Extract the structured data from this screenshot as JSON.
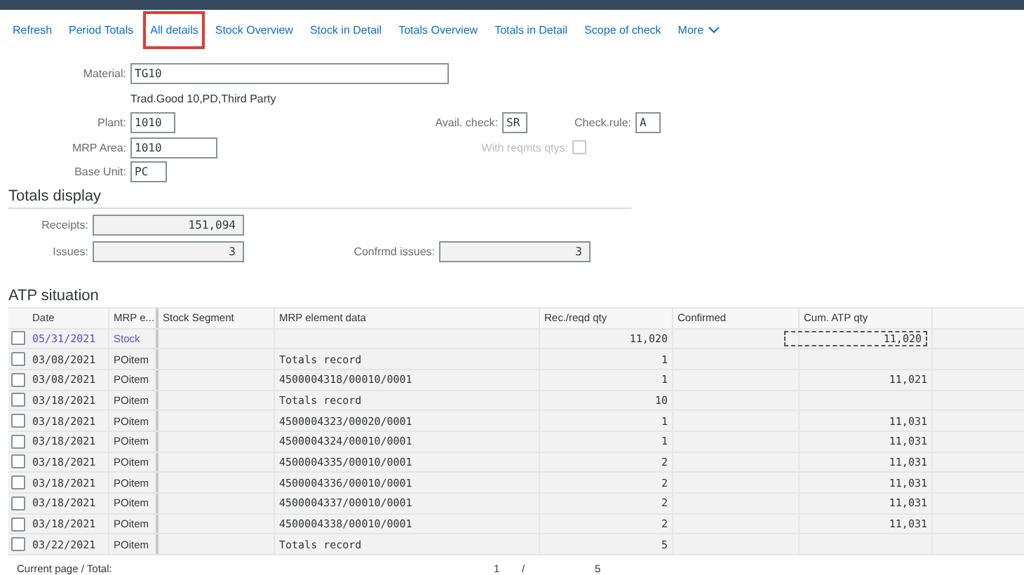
{
  "toolbar": [
    {
      "label": "Refresh",
      "highlighted": false
    },
    {
      "label": "Period Totals",
      "highlighted": false
    },
    {
      "label": "All details",
      "highlighted": true
    },
    {
      "label": "Stock Overview",
      "highlighted": false
    },
    {
      "label": "Stock in Detail",
      "highlighted": false
    },
    {
      "label": "Totals Overview",
      "highlighted": false
    },
    {
      "label": "Totals in Detail",
      "highlighted": false
    },
    {
      "label": "Scope of check",
      "highlighted": false
    }
  ],
  "more": {
    "label": "More"
  },
  "header": {
    "material_label": "Material:",
    "material": "TG10",
    "description": "Trad.Good 10,PD,Third Party",
    "plant_label": "Plant:",
    "plant": "1010",
    "avail_label": "Avail. check:",
    "avail": "SR",
    "rule_label": "Check.rule:",
    "rule": "A",
    "mrp_area_label": "MRP Area:",
    "mrp_area": "1010",
    "reqmts_label": "With reqmts qtys:",
    "reqmts_checked": false,
    "unit_label": "Base Unit:",
    "unit": "PC"
  },
  "totals": {
    "title": "Totals display",
    "receipts_label": "Receipts:",
    "receipts": "151,094",
    "issues_label": "Issues:",
    "issues": "3",
    "confirmed_label": "Confrmd issues:",
    "confirmed": "3"
  },
  "atp": {
    "title": "ATP situation",
    "columns": [
      "Date",
      "MRP e...",
      "Stock Segment",
      "MRP element data",
      "Rec./reqd qty",
      "Confirmed",
      "Cum. ATP qty"
    ],
    "rows": [
      {
        "kind": "stock",
        "selected": false,
        "focused": true,
        "cells": [
          "05/31/2021",
          "Stock",
          "",
          "",
          "11,020",
          "",
          "11,020"
        ]
      },
      {
        "kind": "item",
        "selected": false,
        "focused": false,
        "cells": [
          "03/08/2021",
          "POitem",
          "",
          "Totals record",
          "1",
          "",
          ""
        ]
      },
      {
        "kind": "item",
        "selected": false,
        "focused": false,
        "cells": [
          "03/08/2021",
          "POitem",
          "",
          "4500004318/00010/0001",
          "1",
          "",
          "11,021"
        ]
      },
      {
        "kind": "item",
        "selected": false,
        "focused": false,
        "cells": [
          "03/18/2021",
          "POitem",
          "",
          "Totals record",
          "10",
          "",
          ""
        ]
      },
      {
        "kind": "item",
        "selected": false,
        "focused": false,
        "cells": [
          "03/18/2021",
          "POitem",
          "",
          "4500004323/00020/0001",
          "1",
          "",
          "11,031"
        ]
      },
      {
        "kind": "item",
        "selected": false,
        "focused": false,
        "cells": [
          "03/18/2021",
          "POitem",
          "",
          "4500004324/00010/0001",
          "1",
          "",
          "11,031"
        ]
      },
      {
        "kind": "item",
        "selected": false,
        "focused": false,
        "cells": [
          "03/18/2021",
          "POitem",
          "",
          "4500004335/00010/0001",
          "2",
          "",
          "11,031"
        ]
      },
      {
        "kind": "item",
        "selected": false,
        "focused": false,
        "cells": [
          "03/18/2021",
          "POitem",
          "",
          "4500004336/00010/0001",
          "2",
          "",
          "11,031"
        ]
      },
      {
        "kind": "item",
        "selected": false,
        "focused": false,
        "cells": [
          "03/18/2021",
          "POitem",
          "",
          "4500004337/00010/0001",
          "2",
          "",
          "11,031"
        ]
      },
      {
        "kind": "item",
        "selected": false,
        "focused": false,
        "cells": [
          "03/18/2021",
          "POitem",
          "",
          "4500004338/00010/0001",
          "2",
          "",
          "11,031"
        ]
      },
      {
        "kind": "item",
        "selected": false,
        "focused": false,
        "cells": [
          "03/22/2021",
          "POitem",
          "",
          "Totals record",
          "5",
          "",
          ""
        ]
      }
    ]
  },
  "footer": {
    "label": "Current page / Total:",
    "page": "1",
    "separator": "/",
    "total": "5"
  }
}
